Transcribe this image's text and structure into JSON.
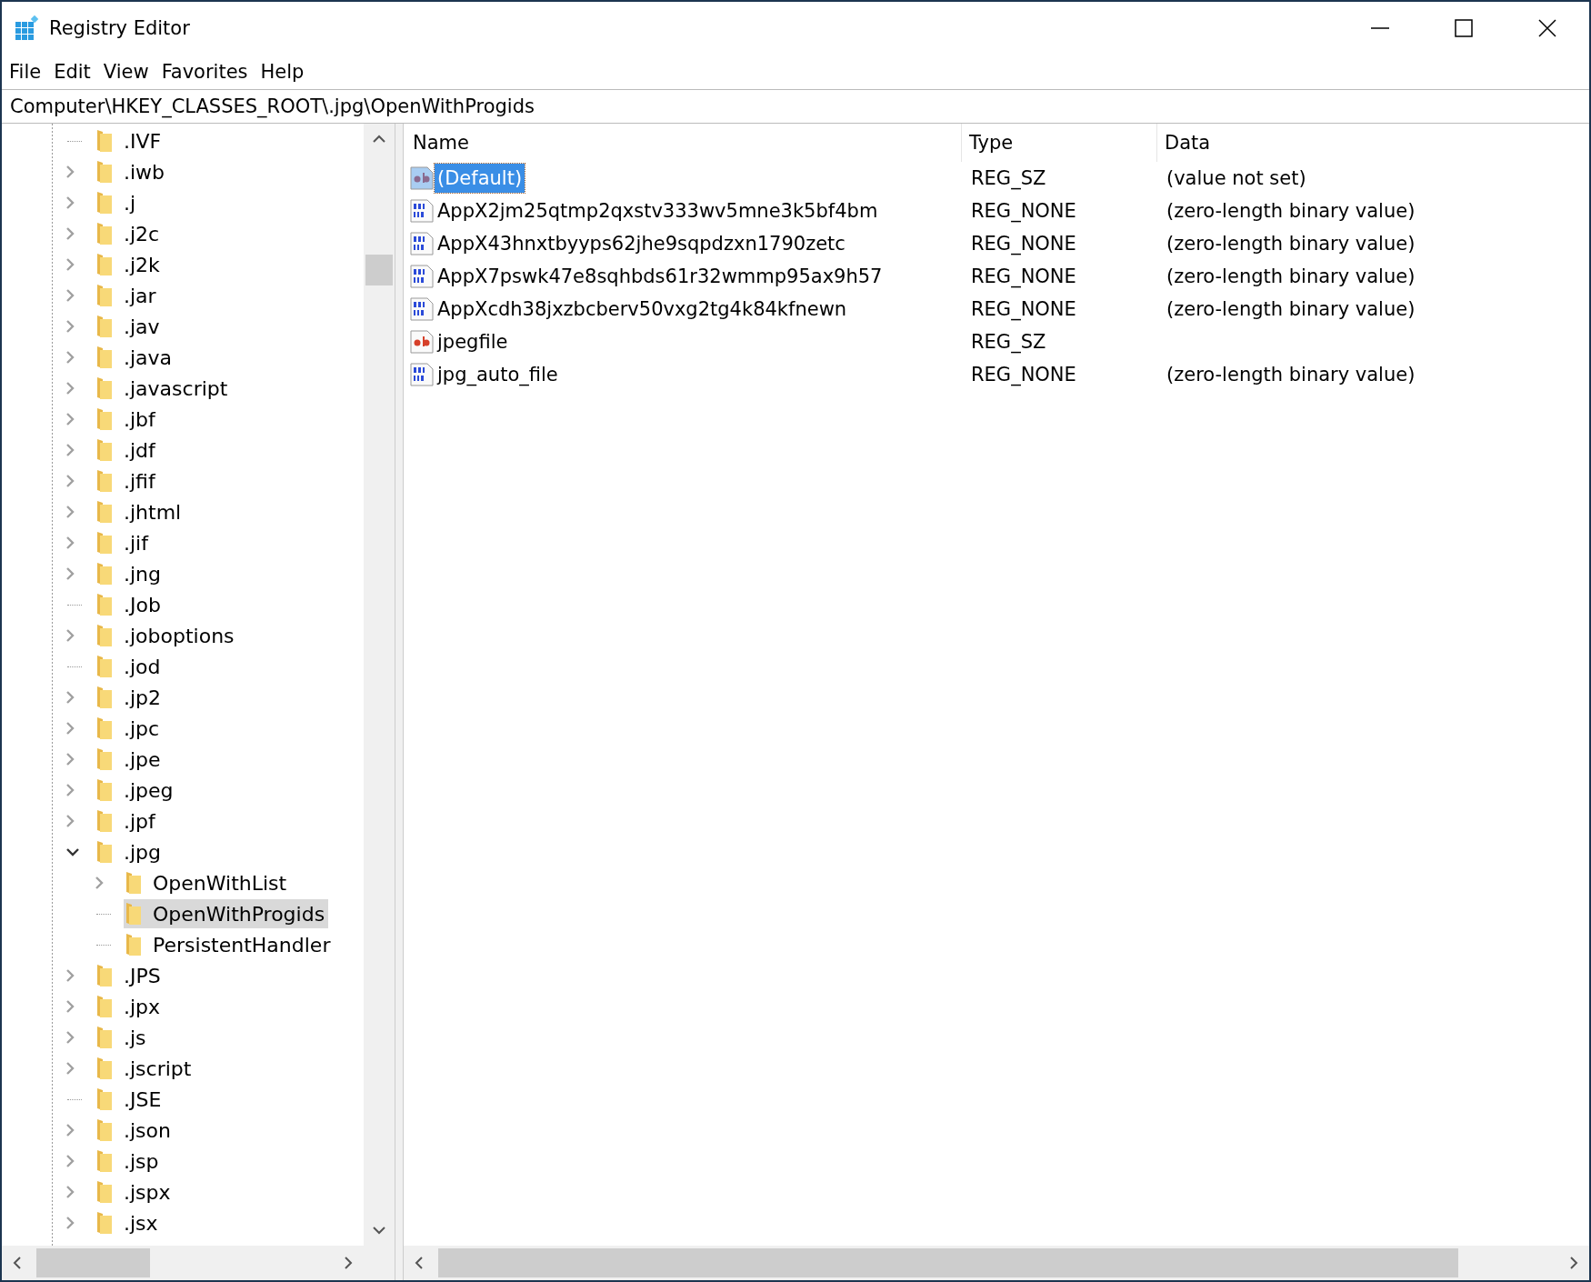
{
  "window": {
    "title": "Registry Editor"
  },
  "menu": [
    "File",
    "Edit",
    "View",
    "Favorites",
    "Help"
  ],
  "address": "Computer\\HKEY_CLASSES_ROOT\\.jpg\\OpenWithProgids",
  "tree": {
    "items": [
      {
        "name": ".IVF",
        "selected": false
      },
      {
        "name": ".iwb",
        "expanded": false,
        "selected": false
      },
      {
        "name": ".j",
        "expanded": false,
        "selected": false
      },
      {
        "name": ".j2c",
        "expanded": false,
        "selected": false
      },
      {
        "name": ".j2k",
        "expanded": false,
        "selected": false
      },
      {
        "name": ".jar",
        "expanded": false,
        "selected": false
      },
      {
        "name": ".jav",
        "expanded": false,
        "selected": false
      },
      {
        "name": ".java",
        "expanded": false,
        "selected": false
      },
      {
        "name": ".javascript",
        "expanded": false,
        "selected": false
      },
      {
        "name": ".jbf",
        "expanded": false,
        "selected": false
      },
      {
        "name": ".jdf",
        "expanded": false,
        "selected": false
      },
      {
        "name": ".jfif",
        "expanded": false,
        "selected": false
      },
      {
        "name": ".jhtml",
        "expanded": false,
        "selected": false
      },
      {
        "name": ".jif",
        "expanded": false,
        "selected": false
      },
      {
        "name": ".jng",
        "expanded": false,
        "selected": false
      },
      {
        "name": ".Job",
        "selected": false
      },
      {
        "name": ".joboptions",
        "expanded": false,
        "selected": false
      },
      {
        "name": ".jod",
        "selected": false
      },
      {
        "name": ".jp2",
        "expanded": false,
        "selected": false
      },
      {
        "name": ".jpc",
        "expanded": false,
        "selected": false
      },
      {
        "name": ".jpe",
        "expanded": false,
        "selected": false
      },
      {
        "name": ".jpeg",
        "expanded": false,
        "selected": false
      },
      {
        "name": ".jpf",
        "expanded": false,
        "selected": false
      },
      {
        "name": ".jpg",
        "expanded": true,
        "selected": false,
        "children": [
          {
            "name": "OpenWithList",
            "expanded": false,
            "selected": false
          },
          {
            "name": "OpenWithProgids",
            "selected": true
          },
          {
            "name": "PersistentHandler",
            "selected": false
          }
        ]
      },
      {
        "name": ".JPS",
        "expanded": false,
        "selected": false
      },
      {
        "name": ".jpx",
        "expanded": false,
        "selected": false
      },
      {
        "name": ".js",
        "expanded": false,
        "selected": false
      },
      {
        "name": ".jscript",
        "expanded": false,
        "selected": false
      },
      {
        "name": ".JSE",
        "selected": false
      },
      {
        "name": ".json",
        "expanded": false,
        "selected": false
      },
      {
        "name": ".jsp",
        "expanded": false,
        "selected": false
      },
      {
        "name": ".jspx",
        "expanded": false,
        "selected": false
      },
      {
        "name": ".jsx",
        "expanded": false,
        "selected": false
      }
    ]
  },
  "table": {
    "columns": [
      "Name",
      "Type",
      "Data"
    ],
    "rows": [
      {
        "kind": "string",
        "name": "(Default)",
        "type": "REG_SZ",
        "data": "(value not set)",
        "selected": true
      },
      {
        "kind": "binary",
        "name": "AppX2jm25qtmp2qxstv333wv5mne3k5bf4bm",
        "type": "REG_NONE",
        "data": "(zero-length binary value)",
        "selected": false
      },
      {
        "kind": "binary",
        "name": "AppX43hnxtbyyps62jhe9sqpdzxn1790zetc",
        "type": "REG_NONE",
        "data": "(zero-length binary value)",
        "selected": false
      },
      {
        "kind": "binary",
        "name": "AppX7pswk47e8sqhbds61r32wmmp95ax9h57",
        "type": "REG_NONE",
        "data": "(zero-length binary value)",
        "selected": false
      },
      {
        "kind": "binary",
        "name": "AppXcdh38jxzbcberv50vxg2tg4k84kfnewn",
        "type": "REG_NONE",
        "data": "(zero-length binary value)",
        "selected": false
      },
      {
        "kind": "string",
        "name": "jpegfile",
        "type": "REG_SZ",
        "selected": false
      },
      {
        "kind": "binary",
        "name": "jpg_auto_file",
        "type": "REG_NONE",
        "data": "(zero-length binary value)",
        "selected": false
      }
    ]
  }
}
